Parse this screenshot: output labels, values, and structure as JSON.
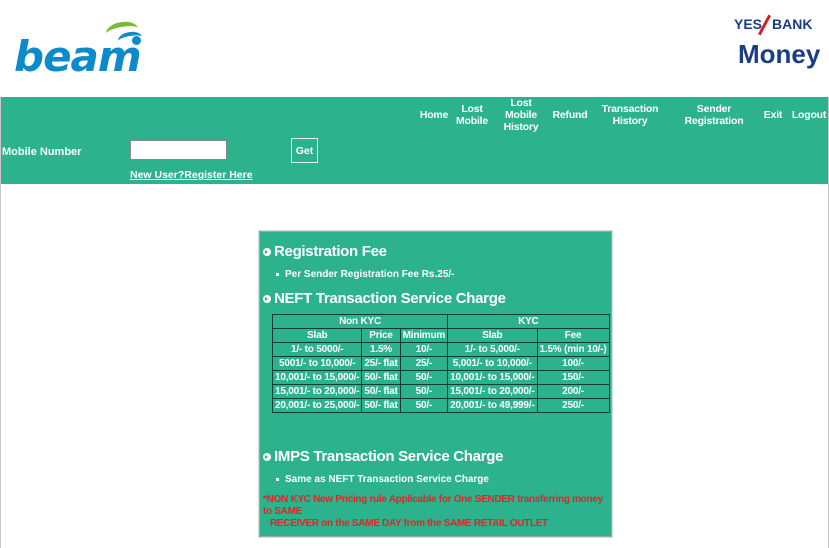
{
  "header": {
    "logo_left": "beam",
    "logo_right_top_left": "YES",
    "logo_right_top_right": "BANK",
    "logo_right_bottom": "Money"
  },
  "nav": [
    {
      "label": "Home",
      "name": "nav-home"
    },
    {
      "label": "Lost\nMobile",
      "name": "nav-lost-mobile"
    },
    {
      "label": "Lost Mobile\nHistory",
      "name": "nav-lost-mobile-history"
    },
    {
      "label": "Refund",
      "name": "nav-refund"
    },
    {
      "label": "Transaction History",
      "name": "nav-transaction-history"
    },
    {
      "label": "Sender Registration",
      "name": "nav-sender-registration"
    },
    {
      "label": "Exit",
      "name": "nav-exit"
    },
    {
      "label": "Logout",
      "name": "nav-logout"
    }
  ],
  "form": {
    "mobile_label": "Mobile Number",
    "mobile_value": "",
    "get_label": "Get",
    "register_link": "New User?Register Here"
  },
  "charges": {
    "registration": {
      "title": "Registration Fee",
      "item": "Per Sender Registration Fee Rs.25/-"
    },
    "neft": {
      "title": "NEFT Transaction Service Charge",
      "group_non_kyc": "Non KYC",
      "group_kyc": "KYC",
      "columns": [
        "Slab",
        "Price",
        "Minimum",
        "Slab",
        "Fee"
      ],
      "rows": [
        [
          "1/- to 5000/-",
          "1.5%",
          "10/-",
          "1/- to 5,000/-",
          "1.5% (min 10/-)"
        ],
        [
          "5001/- to 10,000/-",
          "25/- flat",
          "25/-",
          "5,001/- to 10,000/-",
          "100/-"
        ],
        [
          "10,001/- to 15,000/-",
          "50/- flat",
          "50/-",
          "10,001/- to 15,000/-",
          "150/-"
        ],
        [
          "15,001/- to 20,000/-",
          "50/- flat",
          "50/-",
          "15,001/- to 20,000/-",
          "200/-"
        ],
        [
          "20,001/- to 25,000/-",
          "50/- flat",
          "50/-",
          "20,001/- to 49,999/-",
          "250/-"
        ]
      ]
    },
    "imps": {
      "title": "IMPS Transaction Service Charge",
      "item": "Same as NEFT Transaction Service Charge"
    },
    "note_line1": "*NON KYC New Pricing rule Applicable for One SENDER transferring money to SAME",
    "note_line2": "RECEIVER on the SAME DAY from the SAME RETAIL OUTLET"
  },
  "colors": {
    "teal": "#2db28e",
    "note_red": "#e8202a",
    "brand_blue": "#0b8bc9",
    "yes_navy": "#1b3d84"
  }
}
